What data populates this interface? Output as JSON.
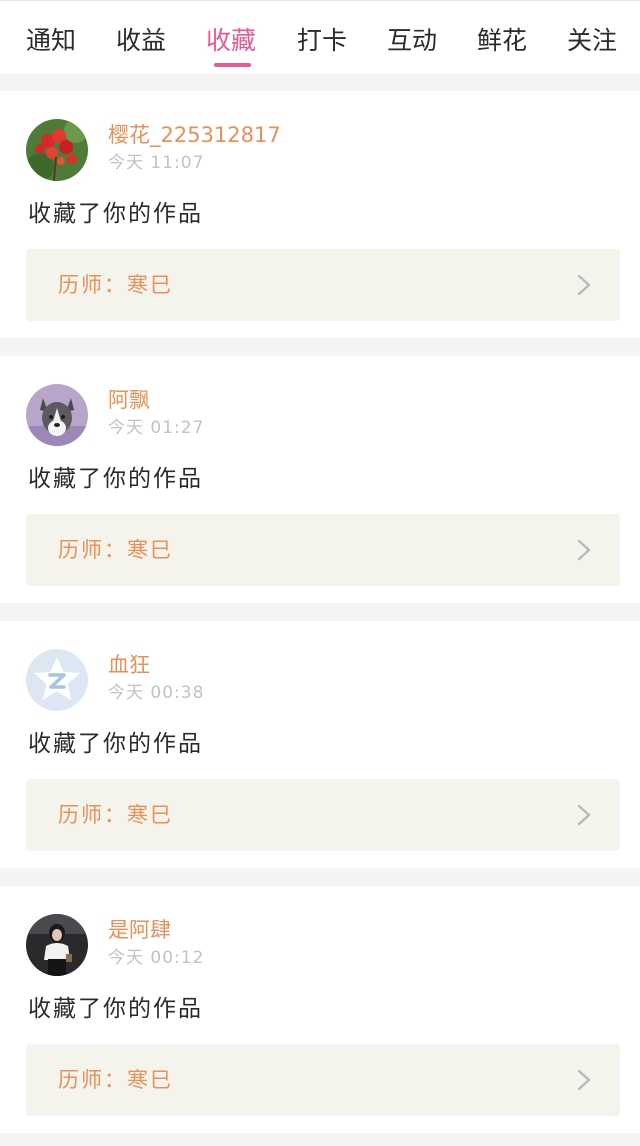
{
  "tabs": [
    {
      "label": "通知",
      "active": false
    },
    {
      "label": "收益",
      "active": false
    },
    {
      "label": "收藏",
      "active": true
    },
    {
      "label": "打卡",
      "active": false
    },
    {
      "label": "互动",
      "active": false
    },
    {
      "label": "鲜花",
      "active": false
    },
    {
      "label": "关注",
      "active": false
    }
  ],
  "colors": {
    "accent": "#e75a9a",
    "username": "#e8905a",
    "work_box_bg": "#f4f3ec",
    "page_bg": "#f4f4f4"
  },
  "items": [
    {
      "username": "樱花_225312817",
      "time": "今天 11:07",
      "action": "收藏了你的作品",
      "work": "历师：寒巳",
      "avatar_icon": "red-berries-avatar"
    },
    {
      "username": "阿飘",
      "time": "今天 01:27",
      "action": "收藏了你的作品",
      "work": "历师：寒巳",
      "avatar_icon": "husky-dog-avatar"
    },
    {
      "username": "血狂",
      "time": "今天 00:38",
      "action": "收藏了你的作品",
      "work": "历师：寒巳",
      "avatar_icon": "default-star-avatar"
    },
    {
      "username": "是阿肆",
      "time": "今天 00:12",
      "action": "收藏了你的作品",
      "work": "历师：寒巳",
      "avatar_icon": "girl-photo-avatar"
    }
  ]
}
